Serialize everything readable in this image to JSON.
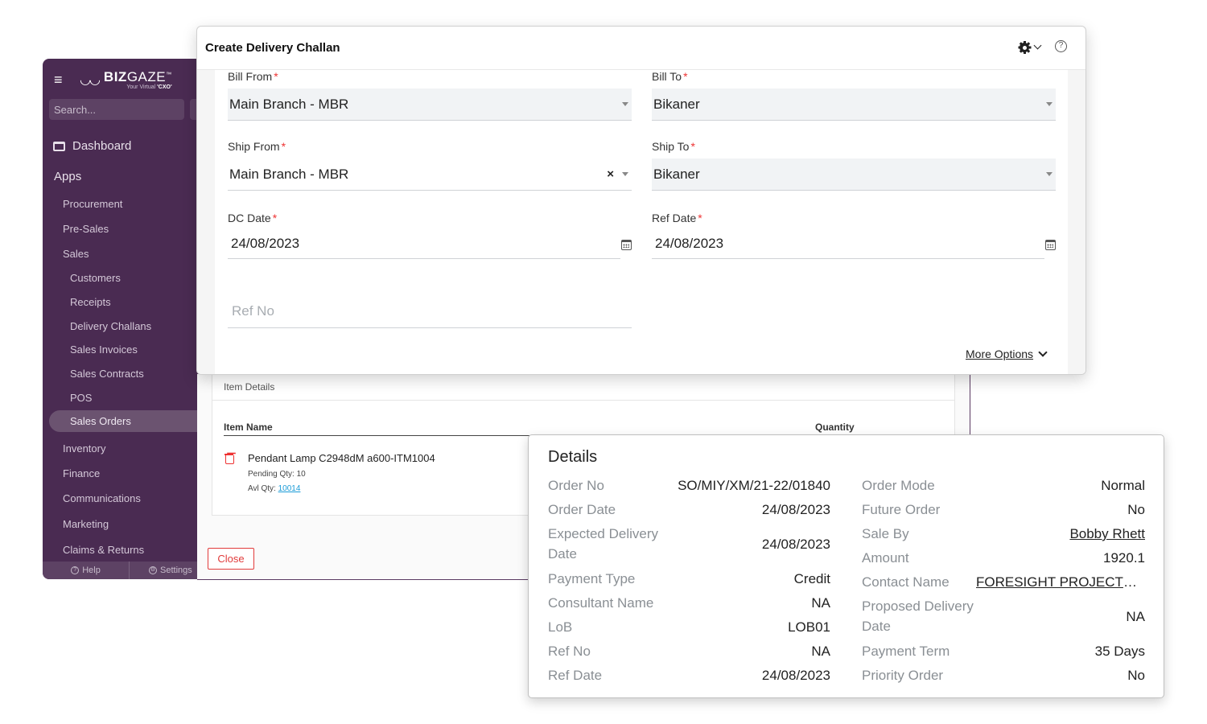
{
  "sidebar": {
    "brand_main": "BIZ",
    "brand_light": "GAZE",
    "brand_tm": "™",
    "brand_tagline_pre": "Your Virtual ",
    "brand_tagline_bold": "'CXO'",
    "search_placeholder": "Search...",
    "dashboard": "Dashboard",
    "apps": "Apps",
    "items": [
      {
        "label": "Procurement"
      },
      {
        "label": "Pre-Sales"
      },
      {
        "label": "Sales"
      },
      {
        "label": "Customers"
      },
      {
        "label": "Receipts"
      },
      {
        "label": "Delivery Challans"
      },
      {
        "label": "Sales Invoices"
      },
      {
        "label": "Sales Contracts"
      },
      {
        "label": "POS"
      },
      {
        "label": "Sales Orders"
      },
      {
        "label": "Inventory"
      },
      {
        "label": "Finance"
      },
      {
        "label": "Communications"
      },
      {
        "label": "Marketing"
      },
      {
        "label": "Claims & Returns"
      }
    ],
    "footer_help": "Help",
    "footer_settings": "Settings"
  },
  "modal": {
    "title": "Create Delivery Challan",
    "bill_from": {
      "label": "Bill From",
      "value": "Main Branch - MBR"
    },
    "bill_to": {
      "label": "Bill To",
      "value": "Bikaner"
    },
    "ship_from": {
      "label": "Ship From",
      "value": "Main Branch - MBR"
    },
    "ship_to": {
      "label": "Ship To",
      "value": "Bikaner"
    },
    "dc_date": {
      "label": "DC Date",
      "value": "24/08/2023"
    },
    "ref_date": {
      "label": "Ref Date",
      "value": "24/08/2023"
    },
    "ref_no": {
      "placeholder": "Ref No"
    },
    "required_mark": "*",
    "more_options": "More Options"
  },
  "items": {
    "section_title": "Item Details",
    "col_item_name": "Item Name",
    "col_quantity": "Quantity",
    "rows": [
      {
        "name": "Pendant Lamp C2948dM a600-ITM1004",
        "pending_label": "Pending Qty: 10",
        "avl_label": "Avl Qty: ",
        "avl_value": "10014"
      }
    ],
    "close_label": "Close"
  },
  "details": {
    "title": "Details",
    "left": [
      {
        "label": "Order No",
        "value": "SO/MIY/XM/21-22/01840"
      },
      {
        "label": "Order Date",
        "value": "24/08/2023"
      },
      {
        "label": "Expected Delivery Date",
        "value": "24/08/2023"
      },
      {
        "label": "Payment Type",
        "value": "Credit"
      },
      {
        "label": "Consultant Name",
        "value": "NA"
      },
      {
        "label": "LoB",
        "value": "LOB01"
      },
      {
        "label": "Ref No",
        "value": "NA"
      },
      {
        "label": "Ref Date",
        "value": "24/08/2023"
      }
    ],
    "right": [
      {
        "label": "Order Mode",
        "value": "Normal"
      },
      {
        "label": "Future Order",
        "value": "No"
      },
      {
        "label": "Sale By",
        "value": "Bobby Rhett"
      },
      {
        "label": "Amount",
        "value": "1920.1"
      },
      {
        "label": "Contact Name",
        "value": "FORESIGHT PROJECTS ..."
      },
      {
        "label": "Proposed Delivery Date",
        "value": "NA"
      },
      {
        "label": "Payment Term",
        "value": "35 Days"
      },
      {
        "label": "Priority Order",
        "value": "No"
      }
    ]
  }
}
